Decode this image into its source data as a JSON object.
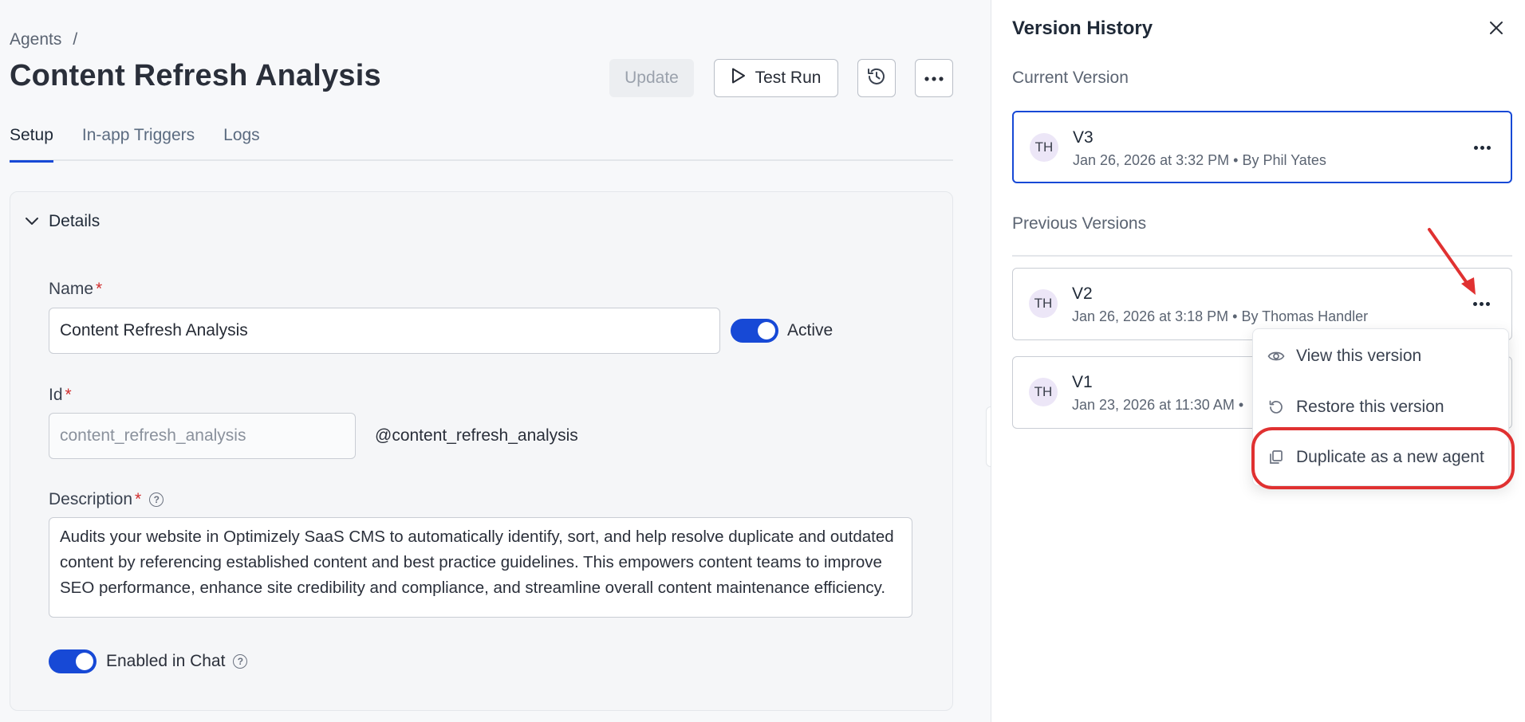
{
  "breadcrumb": {
    "root": "Agents",
    "sep": "/"
  },
  "page": {
    "title": "Content Refresh Analysis"
  },
  "toolbar": {
    "update": "Update",
    "test_run": "Test Run"
  },
  "tabs": [
    {
      "label": "Setup",
      "active": true
    },
    {
      "label": "In-app Triggers",
      "active": false
    },
    {
      "label": "Logs",
      "active": false
    }
  ],
  "details": {
    "section_title": "Details",
    "name_label": "Name",
    "name_value": "Content Refresh Analysis",
    "active_label": "Active",
    "active_on": true,
    "id_label": "Id",
    "id_value": "content_refresh_analysis",
    "id_handle": "@content_refresh_analysis",
    "description_label": "Description",
    "description_value": "Audits your website in Optimizely SaaS CMS to automatically identify, sort, and help resolve duplicate and outdated content by referencing established content and best practice guidelines. This empowers content teams to improve SEO performance, enhance site credibility and compliance, and streamline overall content maintenance efficiency.",
    "chat_label": "Enabled in Chat",
    "chat_on": true,
    "required_mark": "*"
  },
  "version_history": {
    "title": "Version History",
    "current_label": "Current Version",
    "previous_label": "Previous Versions",
    "current": {
      "avatar": "TH",
      "name": "V3",
      "meta": "Jan 26, 2026 at 3:32 PM • By Phil Yates"
    },
    "previous": [
      {
        "avatar": "TH",
        "name": "V2",
        "meta": "Jan 26, 2026 at 3:18 PM • By Thomas Handler"
      },
      {
        "avatar": "TH",
        "name": "V1",
        "meta": "Jan 23, 2026 at 11:30 AM •"
      }
    ],
    "menu": {
      "view": "View this version",
      "restore": "Restore this version",
      "duplicate": "Duplicate as a new agent"
    }
  },
  "colors": {
    "accent": "#1749d6",
    "highlight": "#e03131",
    "required": "#d12d2d"
  },
  "icons": [
    "play-icon",
    "history-icon",
    "more-icon",
    "chevron-down-icon",
    "help-icon",
    "close-icon",
    "eye-icon",
    "restore-icon",
    "duplicate-icon"
  ]
}
